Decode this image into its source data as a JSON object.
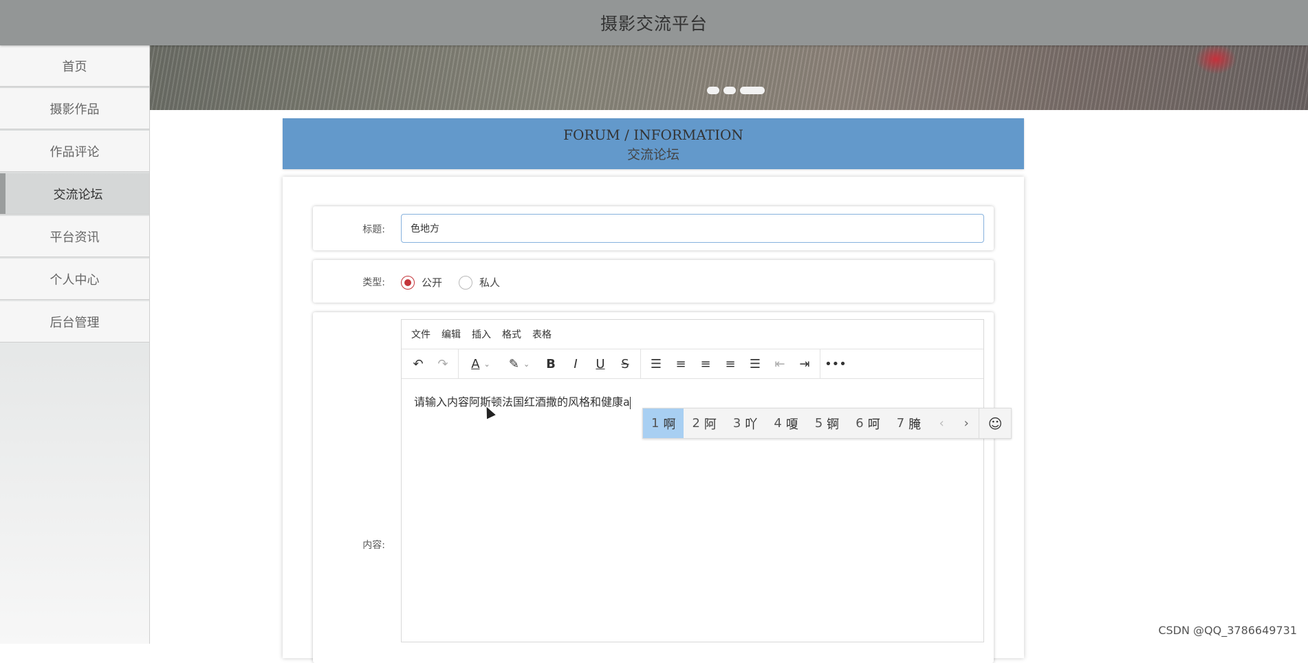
{
  "app": {
    "title": "摄影交流平台"
  },
  "sidebar": {
    "items": [
      {
        "label": "首页"
      },
      {
        "label": "摄影作品"
      },
      {
        "label": "作品评论"
      },
      {
        "label": "交流论坛"
      },
      {
        "label": "平台资讯"
      },
      {
        "label": "个人中心"
      },
      {
        "label": "后台管理"
      }
    ],
    "active_index": 3
  },
  "banner": {
    "slides": 3,
    "active_slide": 3
  },
  "section_header": {
    "en": "FORUM / INFORMATION",
    "cn": "交流论坛"
  },
  "form": {
    "title_label": "标题:",
    "title_value": "色地方",
    "type_label": "类型:",
    "type_options": [
      {
        "label": "公开",
        "checked": true
      },
      {
        "label": "私人",
        "checked": false
      }
    ],
    "content_label": "内容:"
  },
  "editor": {
    "menu": [
      "文件",
      "编辑",
      "插入",
      "格式",
      "表格"
    ],
    "toolbar_icons": [
      "undo-icon",
      "redo-icon",
      "text-color-icon",
      "highlight-color-icon",
      "bold-icon",
      "italic-icon",
      "underline-icon",
      "strikethrough-icon",
      "line-height-icon",
      "align-left-icon",
      "align-center-icon",
      "align-right-icon",
      "align-justify-icon",
      "outdent-icon",
      "indent-icon",
      "more-icon"
    ],
    "content_text": "请输入内容阿斯顿法国红酒撒的风格和健康a"
  },
  "ime": {
    "candidates": [
      {
        "num": "1",
        "text": "啊"
      },
      {
        "num": "2",
        "text": "阿"
      },
      {
        "num": "3",
        "text": "吖"
      },
      {
        "num": "4",
        "text": "嗄"
      },
      {
        "num": "5",
        "text": "锕"
      },
      {
        "num": "6",
        "text": "呵"
      },
      {
        "num": "7",
        "text": "腌"
      }
    ],
    "selected_index": 0
  },
  "watermark": "CSDN @QQ_3786649731",
  "colors": {
    "topbar": "#939696",
    "header_box": "#6399cb",
    "radio_accent": "#c4343a",
    "ime_selected": "#a8cff2"
  }
}
